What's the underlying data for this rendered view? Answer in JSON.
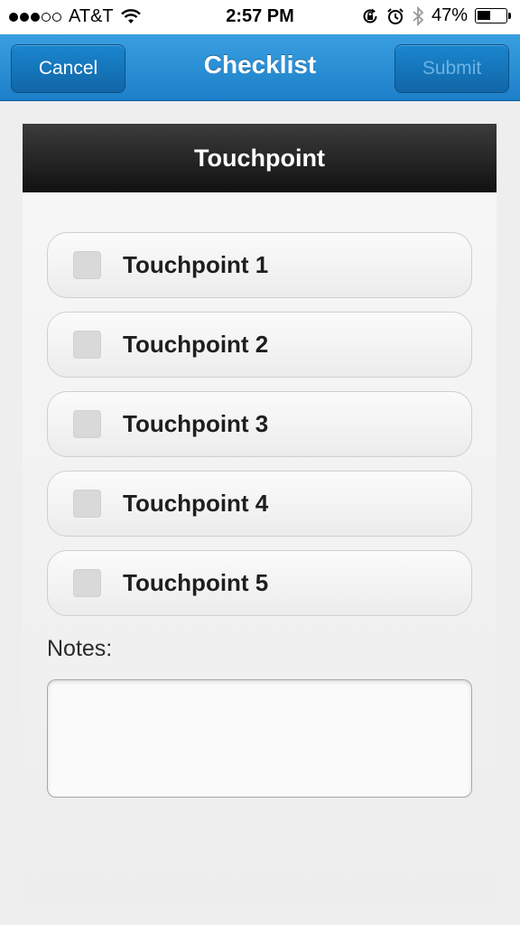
{
  "status_bar": {
    "carrier": "AT&T",
    "time": "2:57 PM",
    "battery_percent": "47%",
    "battery_level": 0.47,
    "signal_bars_filled": 3,
    "signal_bars_total": 5,
    "icons": [
      "wifi-icon",
      "rotation-lock-icon",
      "alarm-icon",
      "bluetooth-icon",
      "battery-icon"
    ]
  },
  "nav": {
    "title": "Checklist",
    "cancel_label": "Cancel",
    "submit_label": "Submit"
  },
  "panel": {
    "header": "Touchpoint",
    "items": [
      {
        "label": "Touchpoint 1",
        "checked": false
      },
      {
        "label": "Touchpoint 2",
        "checked": false
      },
      {
        "label": "Touchpoint 3",
        "checked": false
      },
      {
        "label": "Touchpoint 4",
        "checked": false
      },
      {
        "label": "Touchpoint 5",
        "checked": false
      }
    ],
    "notes_label": "Notes:",
    "notes_value": ""
  },
  "colors": {
    "nav_blue": "#2288d4",
    "header_dark": "#1c1c1c",
    "submit_disabled_text": "#6ab3e6"
  }
}
